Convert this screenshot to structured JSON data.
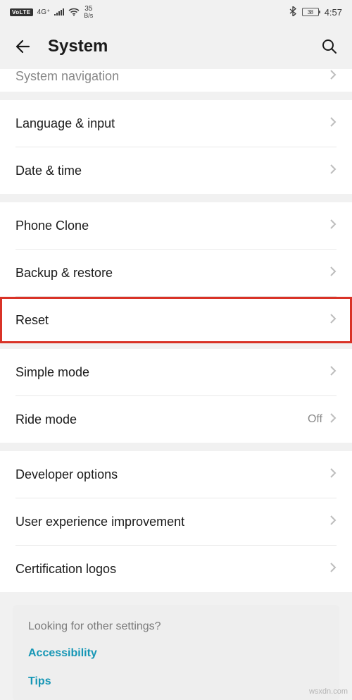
{
  "status": {
    "volte": "VoLTE",
    "net_gen": "4G⁺",
    "rate_num": "35",
    "rate_unit": "B/s",
    "battery_pct": "38",
    "clock": "4:57"
  },
  "appbar": {
    "title": "System"
  },
  "rows": {
    "sys_nav": "System navigation",
    "lang": "Language & input",
    "date": "Date & time",
    "clone": "Phone Clone",
    "backup": "Backup & restore",
    "reset": "Reset",
    "simple": "Simple mode",
    "ride": "Ride mode",
    "ride_value": "Off",
    "dev": "Developer options",
    "ux": "User experience improvement",
    "cert": "Certification logos"
  },
  "card": {
    "heading": "Looking for other settings?",
    "link1": "Accessibility",
    "link2": "Tips"
  },
  "watermark": "wsxdn.com"
}
